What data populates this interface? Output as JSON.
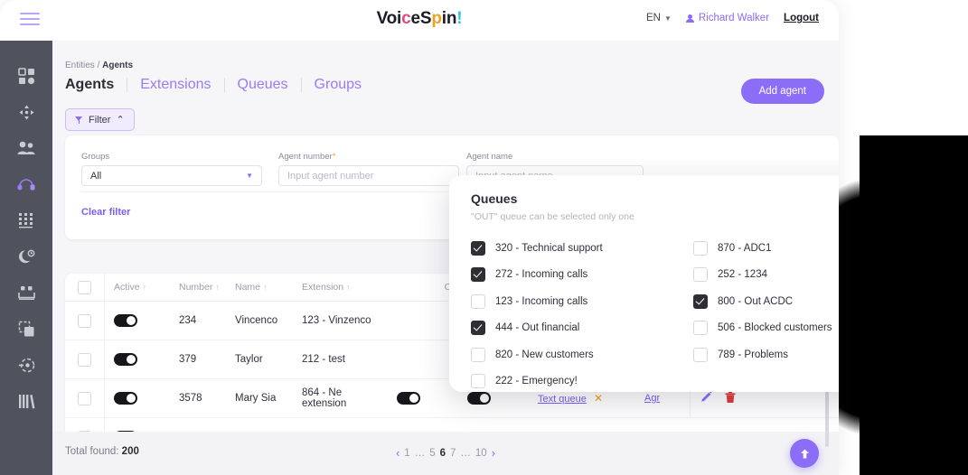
{
  "header": {
    "logo_text": "VoiceSpin!",
    "menu_icon": "hamburger-icon",
    "language": "EN",
    "user_name": "Richard Walker",
    "logout_label": "Logout"
  },
  "sidebar": {
    "items": [
      {
        "icon": "dashboard-grid-icon",
        "active": false
      },
      {
        "icon": "move-arrows-icon",
        "active": false
      },
      {
        "icon": "users-icon",
        "active": false
      },
      {
        "icon": "headset-icon",
        "active": true
      },
      {
        "icon": "keypad-icon",
        "active": false
      },
      {
        "icon": "moon-clock-icon",
        "active": false
      },
      {
        "icon": "voicemail-box-icon",
        "active": false
      },
      {
        "icon": "duplicate-icon",
        "active": false
      },
      {
        "icon": "call-history-icon",
        "active": false
      },
      {
        "icon": "library-icon",
        "active": false
      }
    ]
  },
  "breadcrumb": {
    "root": "Entities",
    "separator": "/",
    "current": "Agents"
  },
  "tabs": [
    {
      "label": "Agents",
      "active": true
    },
    {
      "label": "Extensions",
      "active": false
    },
    {
      "label": "Queues",
      "active": false
    },
    {
      "label": "Groups",
      "active": false
    }
  ],
  "actions": {
    "add_agent": "Add agent",
    "filter": "Filter",
    "filter_chevron": "⌃"
  },
  "filter": {
    "groups_label": "Groups",
    "groups_value": "All",
    "agent_number_label": "Agent number",
    "agent_number_required": "*",
    "agent_number_placeholder": "Input agent number",
    "agent_name_label": "Agent name",
    "agent_name_placeholder": "Input agent name",
    "clear_label": "Clear filter"
  },
  "queues_modal": {
    "title": "Queues",
    "subtitle": "\"OUT\" queue can be selected only one",
    "items": [
      {
        "label": "320 - Technical support",
        "checked": true
      },
      {
        "label": "870 - ADC1",
        "checked": false
      },
      {
        "label": "272 - Incoming calls",
        "checked": true
      },
      {
        "label": "252 - 1234",
        "checked": false
      },
      {
        "label": "123 - Incoming calls",
        "checked": false
      },
      {
        "label": "800 - Out ACDC",
        "checked": true
      },
      {
        "label": "444 - Out financial",
        "checked": true
      },
      {
        "label": "506 - Blocked customers",
        "checked": false
      },
      {
        "label": "820 - New customers",
        "checked": false
      },
      {
        "label": "789 - Problems",
        "checked": false
      },
      {
        "label": "222 - Emergency!",
        "checked": false
      },
      {
        "label": "",
        "checked": false
      }
    ]
  },
  "table": {
    "columns": [
      {
        "label": "Active",
        "sortable": true
      },
      {
        "label": "Number",
        "sortable": true
      },
      {
        "label": "Name",
        "sortable": true
      },
      {
        "label": "Extension",
        "sortable": true
      },
      {
        "label": "CRM ID",
        "sortable": false
      }
    ],
    "sort_arrow": "↑",
    "rows": [
      {
        "active": true,
        "number": "234",
        "name": "Vincenco",
        "extension": "123 - Vinzenco",
        "crm_id": ""
      },
      {
        "active": true,
        "number": "379",
        "name": "Taylor",
        "extension": "212 - test",
        "crm_id": ""
      },
      {
        "active": true,
        "number": "3578",
        "name": "Mary Sia",
        "extension": "864 - Ne extension",
        "crm_id": "",
        "queue_link": "Text queue",
        "queue_remove": "✕",
        "group_link": "Agr",
        "edit_icon": "pencil-icon",
        "delete_icon": "trash-icon"
      }
    ]
  },
  "footer": {
    "total_label": "Total found:",
    "total_value": "200",
    "prev": "‹",
    "next": "›",
    "pages": [
      "1",
      "…",
      "5",
      "6",
      "7",
      "…",
      "10"
    ],
    "current_page": "6",
    "scroll_top_icon": "arrow-up-icon"
  },
  "colors": {
    "accent": "#8c6df8",
    "sidebar": "#50535e",
    "checkbox_on": "#2e2e34",
    "warning": "#f0a020",
    "danger": "#e03b3b"
  }
}
